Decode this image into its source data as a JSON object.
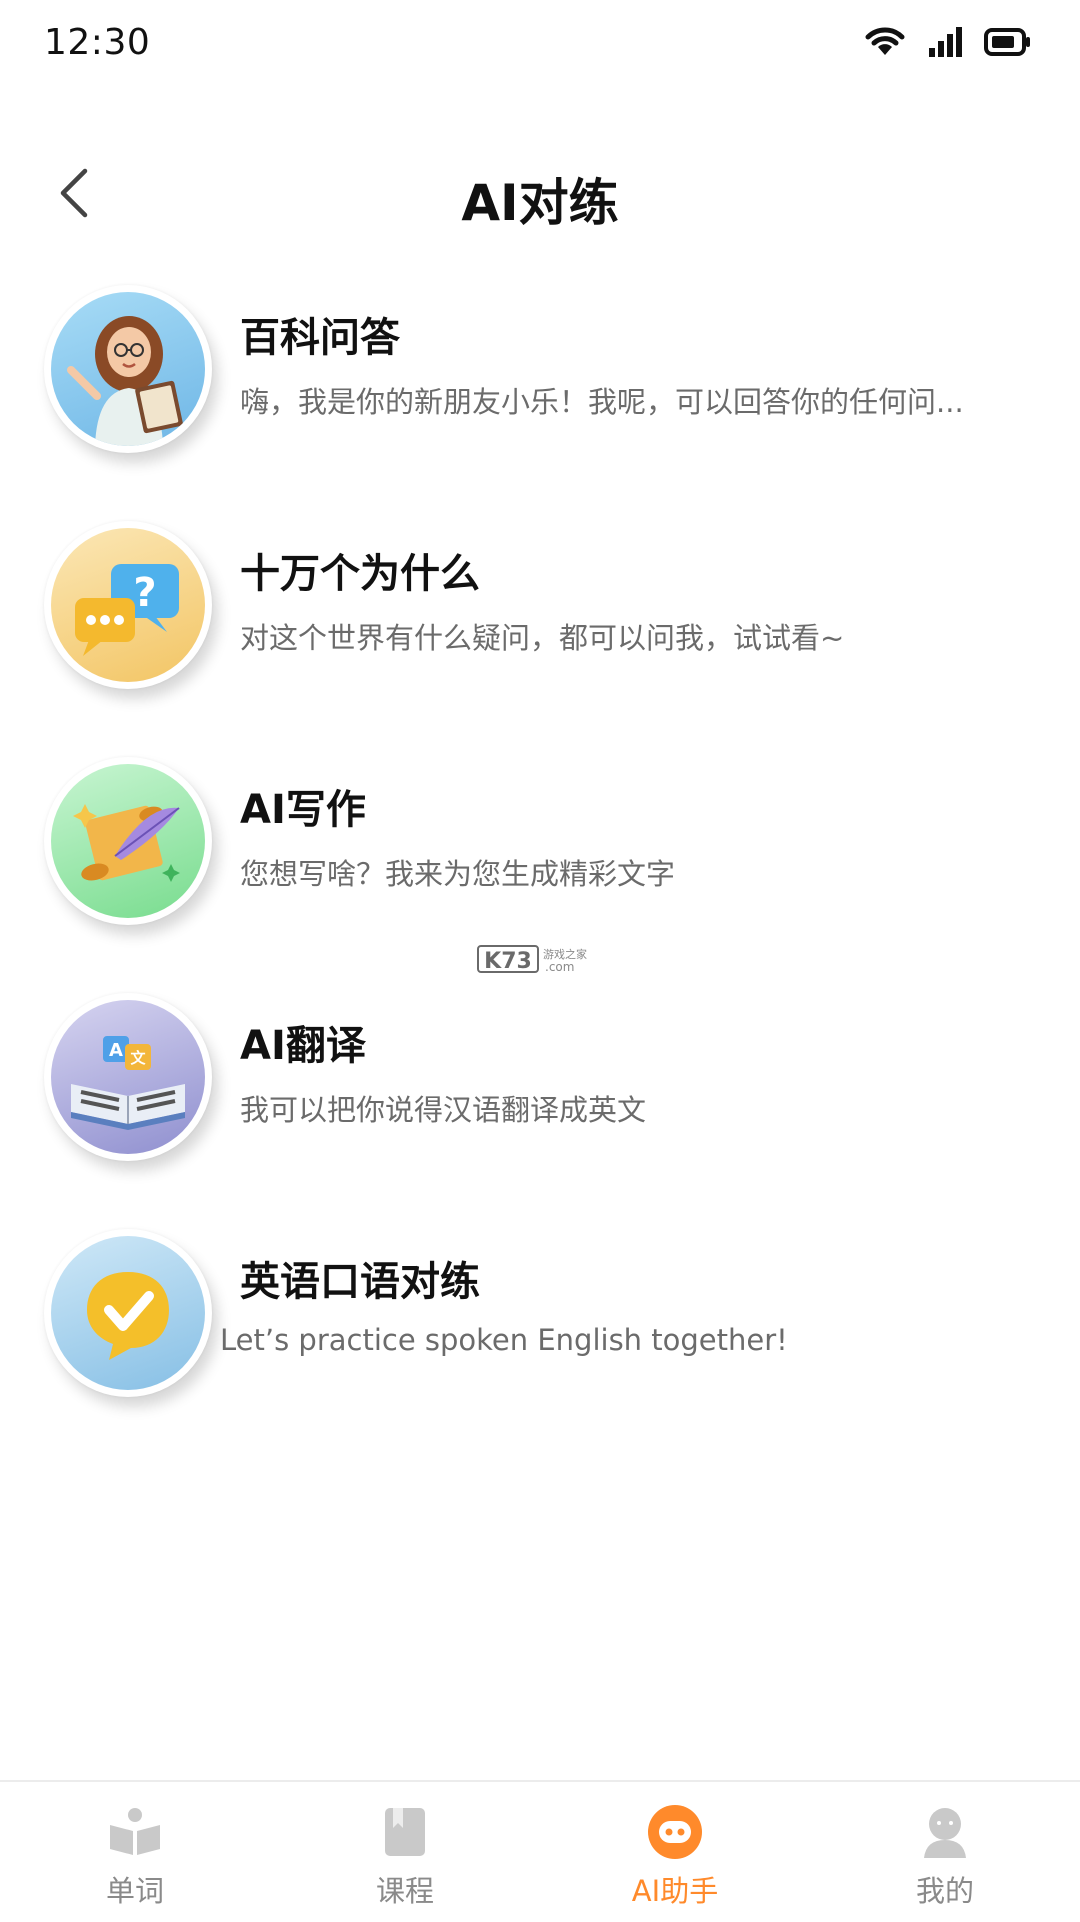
{
  "status_bar": {
    "time": "12:30",
    "icons": [
      "wifi-icon",
      "signal-icon",
      "battery-icon"
    ]
  },
  "header": {
    "back_icon": "chevron-left-icon",
    "title": "AI对练"
  },
  "features": [
    {
      "title": "百科问答",
      "description": "嗨，我是你的新朋友小乐！我呢，可以回答你的任何问...",
      "icon": "teacher-avatar-icon",
      "color": "#8ec9ee"
    },
    {
      "title": "十万个为什么",
      "description": "对这个世界有什么疑问，都可以问我，试试看~",
      "icon": "question-bubbles-icon",
      "color": "#f6d06f"
    },
    {
      "title": "AI写作",
      "description": "您想写啥？我来为您生成精彩文字",
      "icon": "scroll-quill-icon",
      "color": "#8ee6a0"
    },
    {
      "title": "AI翻译",
      "description": "我可以把你说得汉语翻译成英文",
      "icon": "translate-book-icon",
      "color": "#a9a9dc"
    },
    {
      "title": "英语口语对练",
      "description": "Let’s practice spoken English together!",
      "icon": "check-bubble-icon",
      "color": "#a8d2ef"
    }
  ],
  "watermark": {
    "text": "K73",
    "subtext": ".com"
  },
  "bottom_nav": {
    "items": [
      {
        "label": "单词",
        "icon": "book-open-icon",
        "active": false
      },
      {
        "label": "课程",
        "icon": "notebook-icon",
        "active": false
      },
      {
        "label": "AI助手",
        "icon": "ai-bot-icon",
        "active": true
      },
      {
        "label": "我的",
        "icon": "user-icon",
        "active": false
      }
    ],
    "active_color": "#ff8a2b",
    "inactive_color": "#8a8a8a"
  }
}
